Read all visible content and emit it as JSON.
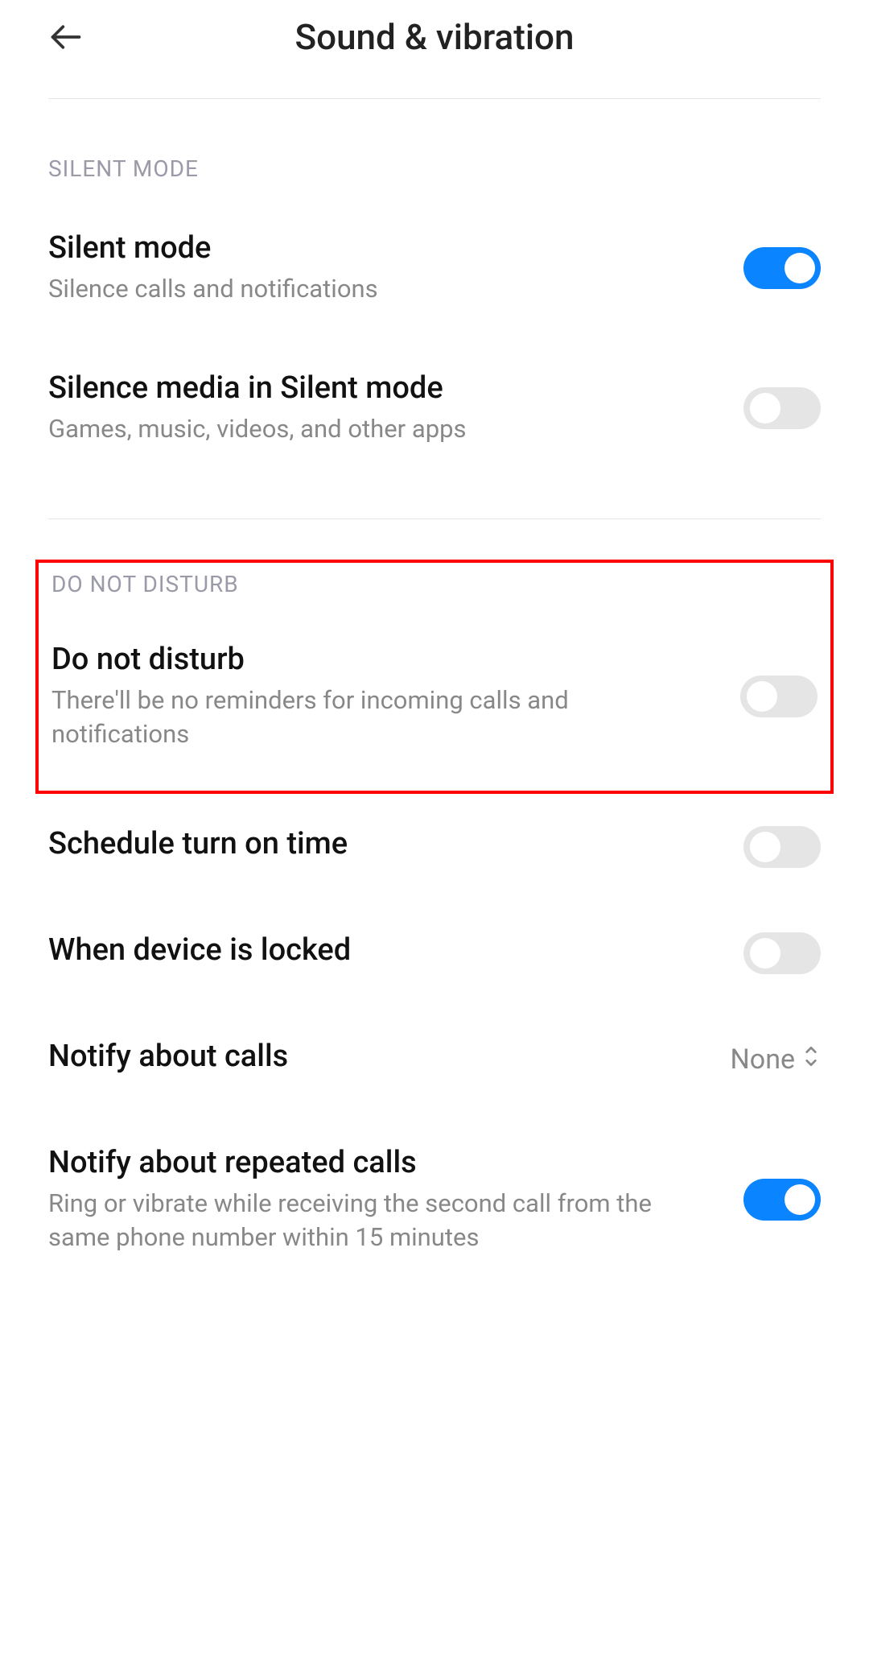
{
  "header": {
    "title": "Sound & vibration"
  },
  "sections": {
    "silent": {
      "header": "SILENT MODE",
      "silent_mode": {
        "title": "Silent mode",
        "subtitle": "Silence calls and notifications",
        "enabled": true
      },
      "silence_media": {
        "title": "Silence media in Silent mode",
        "subtitle": "Games, music, videos, and other apps",
        "enabled": false
      }
    },
    "dnd": {
      "header": "DO NOT DISTURB",
      "do_not_disturb": {
        "title": "Do not disturb",
        "subtitle": "There'll be no reminders for incoming calls and notifications",
        "enabled": false
      },
      "schedule": {
        "title": "Schedule turn on time",
        "enabled": false
      },
      "locked": {
        "title": "When device is locked",
        "enabled": false
      },
      "notify_calls": {
        "title": "Notify about calls",
        "value": "None"
      },
      "repeated_calls": {
        "title": "Notify about repeated calls",
        "subtitle": "Ring or vibrate while receiving the second call from the same phone number within 15 minutes",
        "enabled": true
      }
    }
  }
}
